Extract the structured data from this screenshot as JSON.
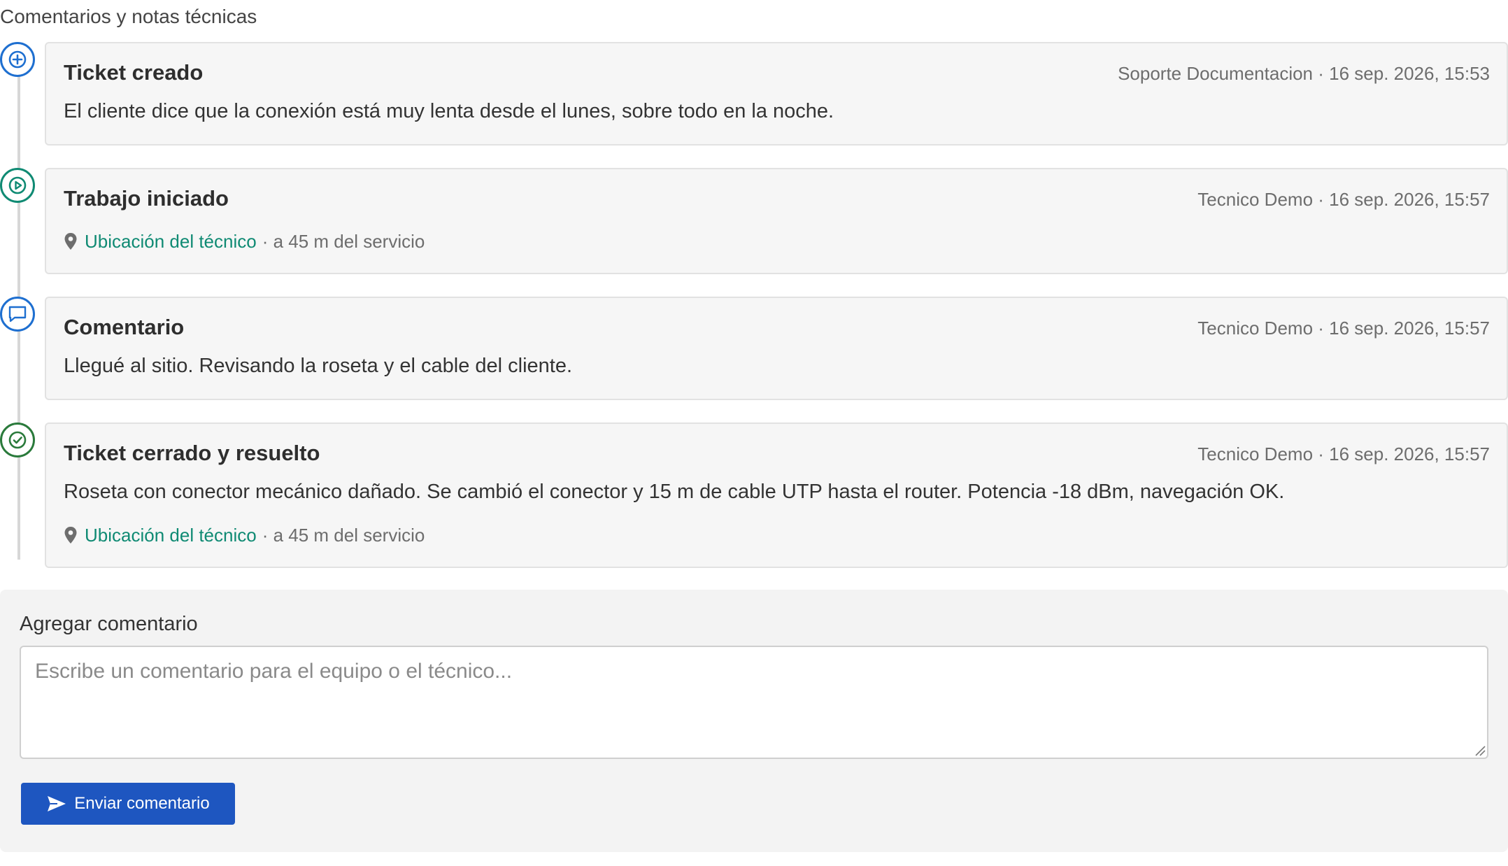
{
  "section": {
    "title": "Comentarios y notas técnicas"
  },
  "events": [
    {
      "icon": "plus-circle-icon",
      "color": "#1e6fd0",
      "title": "Ticket creado",
      "meta": "Soporte Documentacion · 16 sep. 2026, 15:53",
      "body": "El cliente dice que la conexión está muy lenta desde el lunes, sobre todo en la noche."
    },
    {
      "icon": "play-circle-icon",
      "color": "#0f8a73",
      "title": "Trabajo iniciado",
      "meta": "Tecnico Demo · 16 sep. 2026, 15:57",
      "location_link": "Ubicación del técnico",
      "location_distance": "· a 45 m del servicio"
    },
    {
      "icon": "comment-icon",
      "color": "#1e6fd0",
      "title": "Comentario",
      "meta": "Tecnico Demo · 16 sep. 2026, 15:57",
      "body": "Llegué al sitio. Revisando la roseta y el cable del cliente."
    },
    {
      "icon": "check-circle-icon",
      "color": "#2a7a3b",
      "title": "Ticket cerrado y resuelto",
      "meta": "Tecnico Demo · 16 sep. 2026, 15:57",
      "body": "Roseta con conector mecánico dañado. Se cambió el conector y 15 m de cable UTP hasta el router. Potencia -18 dBm, navegación OK.",
      "location_link": "Ubicación del técnico",
      "location_distance": "· a 45 m del servicio"
    }
  ],
  "add_comment": {
    "label": "Agregar comentario",
    "placeholder": "Escribe un comentario para el equipo o el técnico...",
    "value": "",
    "send_label": "Enviar comentario",
    "send_icon": "send-icon",
    "button_color": "#1e56c0"
  }
}
